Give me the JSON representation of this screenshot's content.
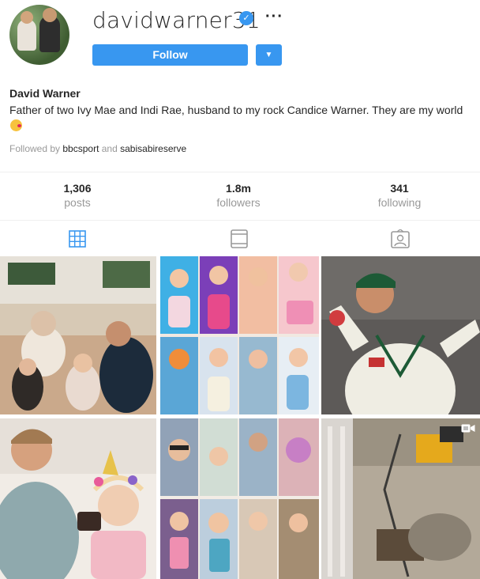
{
  "profile": {
    "username": "davidwarner31",
    "verified_icon": "verified-badge-icon",
    "more_icon": "ellipsis-icon",
    "follow_label": "Follow",
    "dropdown_icon": "caret-down-icon",
    "full_name": "David Warner",
    "bio_text": "Father of two Ivy Mae and Indi Rae, husband to my rock Candice Warner. They are my world",
    "bio_emoji": "kissing-face-emoji-icon",
    "followed_by_prefix": "Followed by",
    "followed_by_user1": "bbcsport",
    "followed_by_and": "and",
    "followed_by_user2": "sabisabireserve"
  },
  "stats": [
    {
      "value": "1,306",
      "label": "posts"
    },
    {
      "value": "1.8m",
      "label": "followers"
    },
    {
      "value": "341",
      "label": "following"
    }
  ],
  "tabs": [
    {
      "icon": "grid-icon",
      "active": true
    },
    {
      "icon": "igtv-icon",
      "active": false
    },
    {
      "icon": "tagged-icon",
      "active": false
    }
  ],
  "posts": [
    {
      "name": "post-family-dinner",
      "type": "photo"
    },
    {
      "name": "post-kids-collage",
      "type": "photo"
    },
    {
      "name": "post-cricketer-celebrating",
      "type": "photo"
    },
    {
      "name": "post-father-daughter-cake",
      "type": "photo"
    },
    {
      "name": "post-family-collage",
      "type": "photo"
    },
    {
      "name": "post-construction-site",
      "type": "video",
      "badge_icon": "video-camera-icon"
    }
  ],
  "colors": {
    "accent": "#3897f0",
    "text": "#262626",
    "muted": "#999999",
    "divider": "#efefef"
  }
}
